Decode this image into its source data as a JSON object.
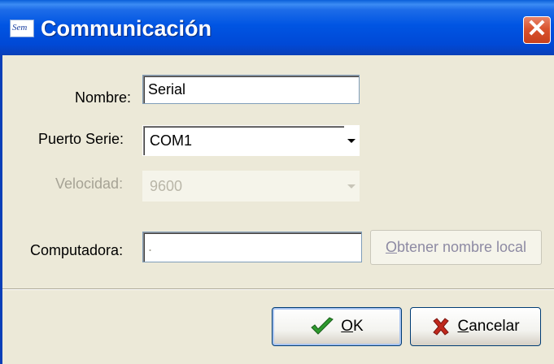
{
  "window": {
    "title": "Communicación",
    "icon_text": "Sem"
  },
  "form": {
    "nombre": {
      "label": "Nombre:",
      "value": "Serial"
    },
    "puerto": {
      "label": "Puerto Serie:",
      "value": "COM1"
    },
    "velocidad": {
      "label": "Velocidad:",
      "value": "9600"
    },
    "computadora": {
      "label": "Computadora:",
      "value": "."
    },
    "local_button": {
      "label_first": "O",
      "label_rest": "btener nombre local"
    }
  },
  "buttons": {
    "ok": {
      "label_first": "O",
      "label_rest": "K"
    },
    "cancel": {
      "label_first": "C",
      "label_rest": "ancelar"
    }
  },
  "colors": {
    "titlebar": "#0055E3",
    "dialog_bg": "#ECE9D8",
    "close": "#D9532E",
    "ok_check": "#2E9A2E",
    "cancel_x": "#C0281C"
  }
}
